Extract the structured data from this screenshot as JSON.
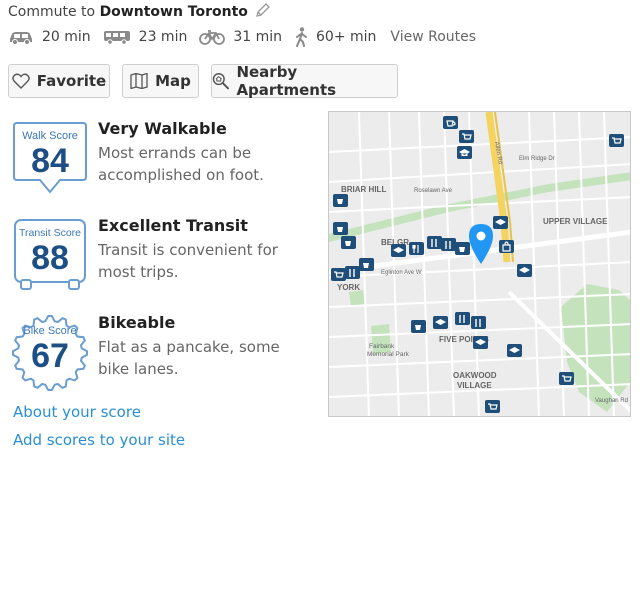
{
  "commute": {
    "prefix": "Commute to",
    "destination": "Downtown Toronto",
    "modes": [
      {
        "icon": "car-icon",
        "time": "20 min"
      },
      {
        "icon": "bus-icon",
        "time": "23 min"
      },
      {
        "icon": "bicycle-icon",
        "time": "31 min"
      },
      {
        "icon": "walking-icon",
        "time": "60+ min"
      }
    ],
    "view_routes": "View Routes"
  },
  "buttons": {
    "favorite": "Favorite",
    "map": "Map",
    "nearby": "Nearby Apartments"
  },
  "scores": [
    {
      "badge_label": "Walk Score",
      "value": "84",
      "title": "Very Walkable",
      "description": "Most errands can be accomplished on foot.",
      "icon": "walk-score-badge-icon"
    },
    {
      "badge_label": "Transit Score",
      "value": "88",
      "title": "Excellent Transit",
      "description": "Transit is convenient for most trips.",
      "icon": "transit-score-badge-icon"
    },
    {
      "badge_label": "Bike Score",
      "value": "67",
      "title": "Bikeable",
      "description": "Flat as a pancake, some bike lanes.",
      "icon": "bike-score-badge-icon"
    }
  ],
  "links": {
    "about": "About your score",
    "add": "Add scores to your site"
  },
  "map": {
    "labels": {
      "briar_hill": "BRIAR HILL",
      "upper_village": "UPPER VILLAGE",
      "five_points": "FIVE POINTS",
      "oakwood": "OAKWOOD",
      "village": "VILLAGE",
      "york": "YORK",
      "belgravia": "BELGR",
      "fairbank": "Fairbank",
      "memorial_park": "Memorial Park",
      "allen_rd": "Allen Rd",
      "elm_ridge": "Elm Ridge Dr",
      "roselawn": "Roselawn Ave",
      "eglinton": "Eglinton Ave W",
      "vaughan": "Vaughan Rd"
    },
    "colors": {
      "marker": "#2196f3",
      "poi": "#1f4e79",
      "park": "#c4e3bd"
    }
  }
}
